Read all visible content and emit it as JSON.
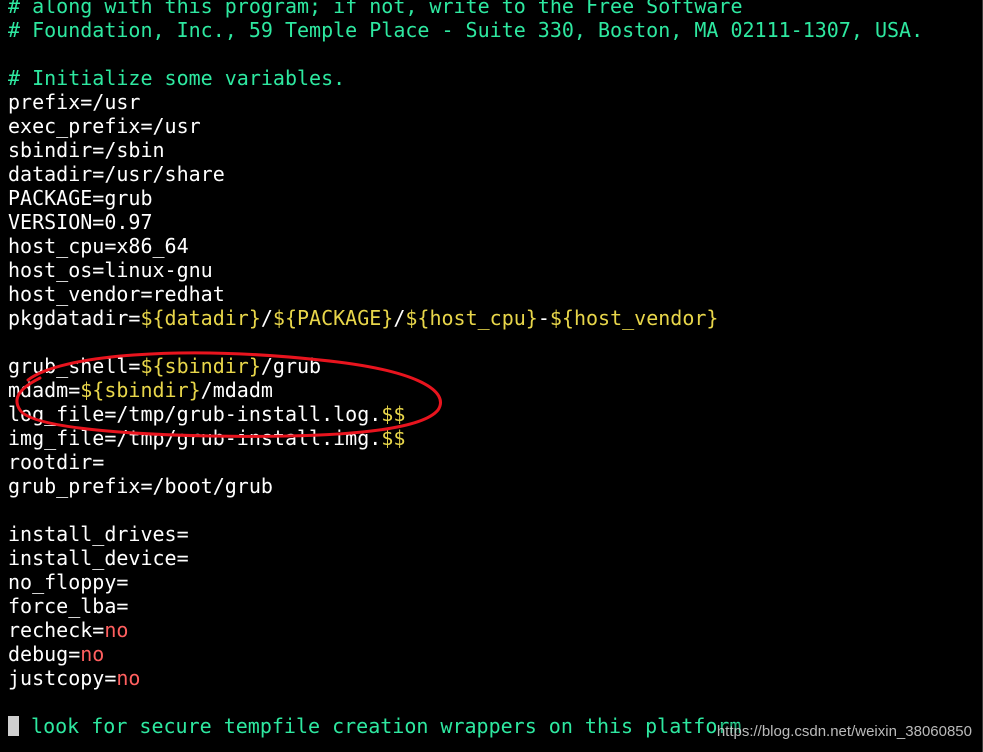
{
  "editor": {
    "lines": [
      [
        {
          "t": "# along with this program; if not, write to the Free Software",
          "c": "comment"
        }
      ],
      [
        {
          "t": "# Foundation, Inc., 59 Temple Place - Suite 330, Boston, MA 02111-1307, USA.",
          "c": "comment"
        }
      ],
      [],
      [
        {
          "t": "# Initialize some variables.",
          "c": "comment"
        }
      ],
      [
        {
          "t": "prefix=/usr",
          "c": "plain"
        }
      ],
      [
        {
          "t": "exec_prefix=/usr",
          "c": "plain"
        }
      ],
      [
        {
          "t": "sbindir=/sbin",
          "c": "plain"
        }
      ],
      [
        {
          "t": "datadir=/usr/share",
          "c": "plain"
        }
      ],
      [
        {
          "t": "PACKAGE=grub",
          "c": "plain"
        }
      ],
      [
        {
          "t": "VERSION=0.97",
          "c": "plain"
        }
      ],
      [
        {
          "t": "host_cpu=x86_64",
          "c": "plain"
        }
      ],
      [
        {
          "t": "host_os=linux-gnu",
          "c": "plain"
        }
      ],
      [
        {
          "t": "host_vendor=redhat",
          "c": "plain"
        }
      ],
      [
        {
          "t": "pkgdatadir=",
          "c": "plain"
        },
        {
          "t": "${datadir}",
          "c": "var"
        },
        {
          "t": "/",
          "c": "plain"
        },
        {
          "t": "${PACKAGE}",
          "c": "var"
        },
        {
          "t": "/",
          "c": "plain"
        },
        {
          "t": "${host_cpu}",
          "c": "var"
        },
        {
          "t": "-",
          "c": "plain"
        },
        {
          "t": "${host_vendor}",
          "c": "var"
        }
      ],
      [],
      [
        {
          "t": "grub_shell=",
          "c": "plain"
        },
        {
          "t": "${sbindir}",
          "c": "var"
        },
        {
          "t": "/grub",
          "c": "plain"
        }
      ],
      [
        {
          "t": "mdadm=",
          "c": "plain"
        },
        {
          "t": "${sbindir}",
          "c": "var"
        },
        {
          "t": "/mdadm",
          "c": "plain"
        }
      ],
      [
        {
          "t": "log_file=/tmp/grub-install.log.",
          "c": "plain"
        },
        {
          "t": "$$",
          "c": "var"
        }
      ],
      [
        {
          "t": "img_file=/tmp/grub-install.img.",
          "c": "plain"
        },
        {
          "t": "$$",
          "c": "var"
        }
      ],
      [
        {
          "t": "rootdir=",
          "c": "plain"
        }
      ],
      [
        {
          "t": "grub_prefix=/boot/grub",
          "c": "plain"
        }
      ],
      [],
      [
        {
          "t": "install_drives=",
          "c": "plain"
        }
      ],
      [
        {
          "t": "install_device=",
          "c": "plain"
        }
      ],
      [
        {
          "t": "no_floppy=",
          "c": "plain"
        }
      ],
      [
        {
          "t": "force_lba=",
          "c": "plain"
        }
      ],
      [
        {
          "t": "recheck=",
          "c": "plain"
        },
        {
          "t": "no",
          "c": "str"
        }
      ],
      [
        {
          "t": "debug=",
          "c": "plain"
        },
        {
          "t": "no",
          "c": "str"
        }
      ],
      [
        {
          "t": "justcopy=",
          "c": "plain"
        },
        {
          "t": "no",
          "c": "str"
        }
      ],
      [],
      [
        {
          "t": "CURSOR",
          "c": "cursor"
        },
        {
          "t": " look for secure tempfile creation wrappers on this platform",
          "c": "comment"
        }
      ]
    ]
  },
  "watermark": "https://blog.csdn.net/weixin_38060850",
  "annotation": {
    "color": "#e8141e",
    "shape": "hand-drawn-ellipse"
  },
  "colors": {
    "background": "#000000",
    "comment": "#2ee8a0",
    "variable": "#e8d64a",
    "string": "#ff5f5f",
    "text": "#ffffff"
  }
}
